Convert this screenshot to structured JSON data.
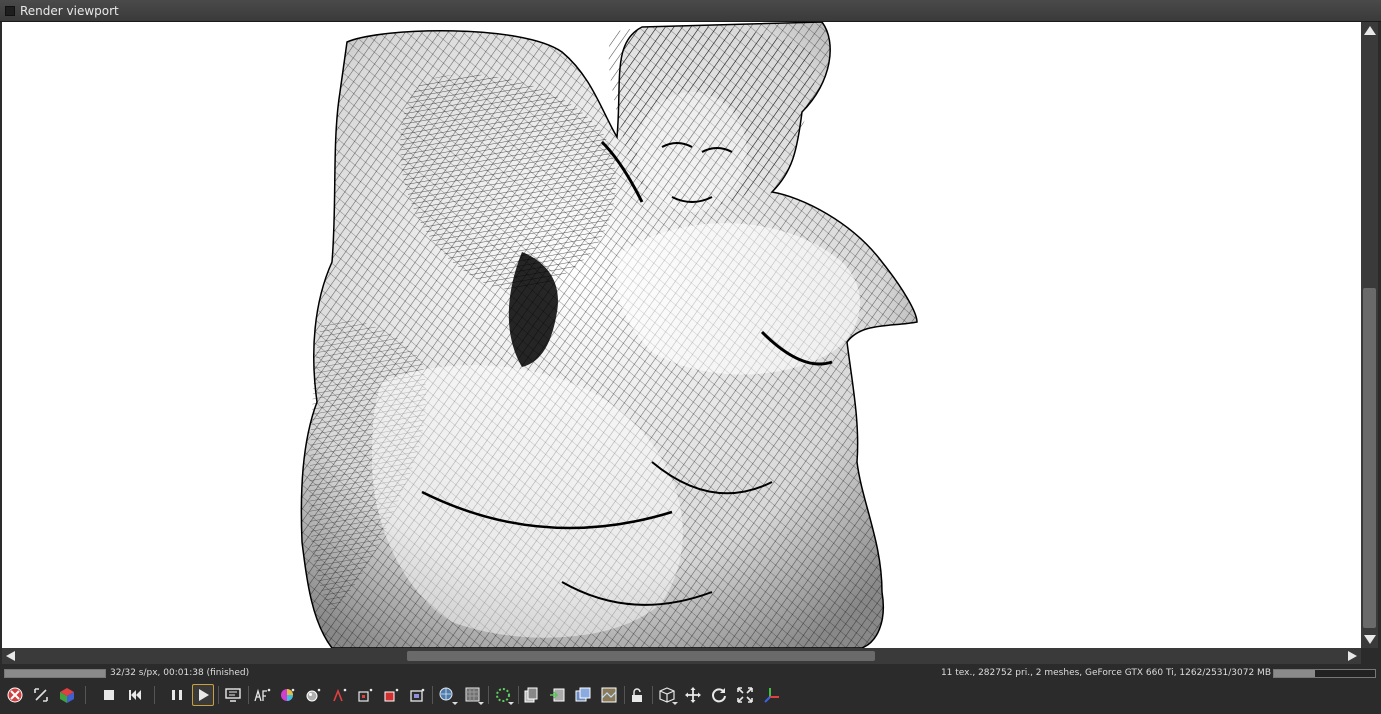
{
  "window": {
    "title": "Render viewport"
  },
  "status": {
    "progress": 1.0,
    "left_text": "32/32 s/px, 00:01:38 (finished)",
    "right_text": "11 tex., 282752 pri., 2 meshes, GeForce GTX 660 Ti, 1262/2531/3072 MB",
    "memory_fraction": 0.41
  },
  "toolbar": {
    "icons": [
      "reset-camera-icon",
      "zoom-region-icon",
      "color-cube-icon",
      "stop-icon",
      "restart-icon",
      "pause-icon",
      "play-icon",
      "display-icon",
      "af-icon",
      "color-picker-icon",
      "material-picker-icon",
      "focus-picker-icon",
      "object-picker-icon",
      "region-picker-icon",
      "film-region-icon",
      "world-icon",
      "render-passes-icon",
      "denoiser-icon",
      "copy-icon",
      "export-icon",
      "clone-icon",
      "texture-icon",
      "lock-icon",
      "view-cube-icon",
      "pan-icon",
      "orbit-icon",
      "fit-icon",
      "axis-gizmo-icon"
    ]
  },
  "colors": {
    "background": "#2b2b2b",
    "viewport": "#ffffff",
    "active_outline": "#c8a040"
  }
}
